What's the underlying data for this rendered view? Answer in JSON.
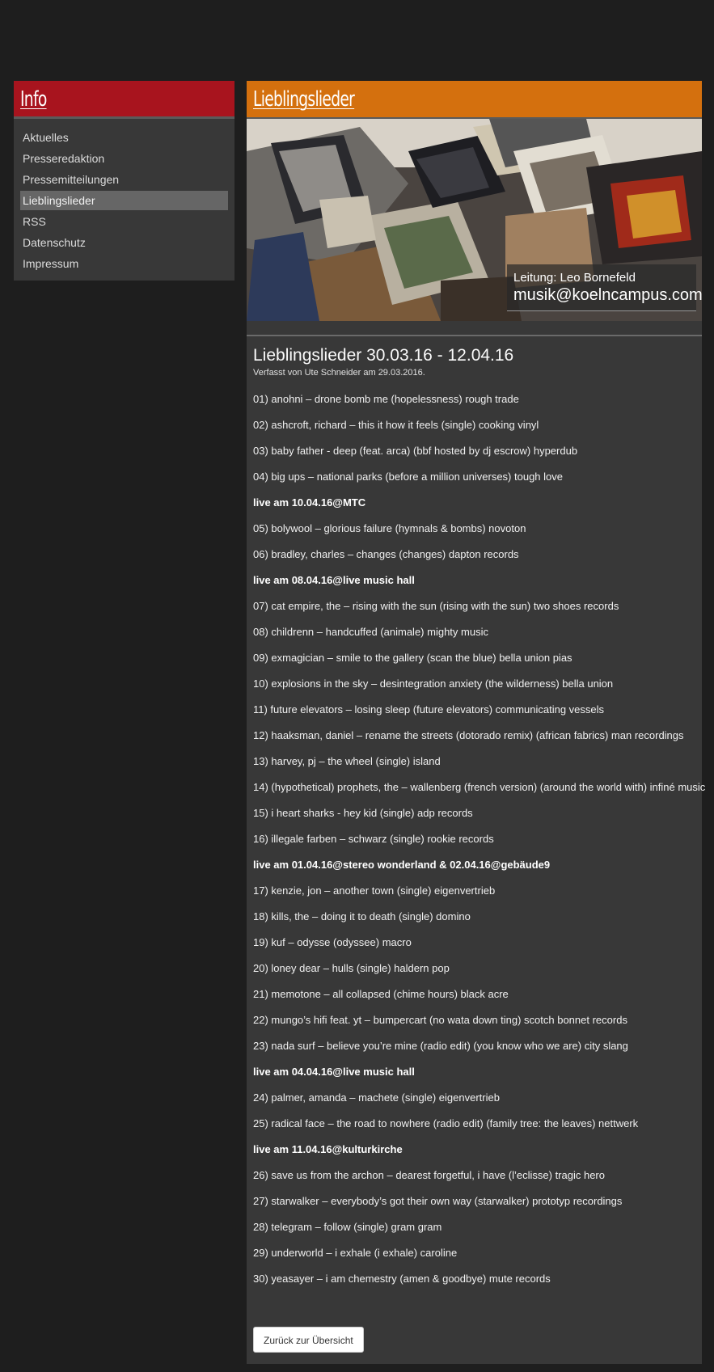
{
  "sidebar": {
    "title": "Info",
    "items": [
      {
        "label": "Aktuelles",
        "active": false
      },
      {
        "label": "Presseredaktion",
        "active": false
      },
      {
        "label": "Pressemitteilungen",
        "active": false
      },
      {
        "label": "Lieblingslieder",
        "active": true
      },
      {
        "label": "RSS",
        "active": false
      },
      {
        "label": "Datenschutz",
        "active": false
      },
      {
        "label": "Impressum",
        "active": false
      }
    ]
  },
  "main": {
    "title": "Lieblingslieder",
    "hero": {
      "leader": "Leitung: Leo Bornefeld",
      "email": "musik@koelncampus.com"
    },
    "article": {
      "title": "Lieblingslieder 30.03.16 - 12.04.16",
      "byline": "Verfasst von Ute Schneider am 29.03.2016.",
      "entries": [
        {
          "text": "01) anohni – drone bomb me (hopelessness) rough trade",
          "live": false
        },
        {
          "text": "02) ashcroft, richard – this it how it feels (single) cooking vinyl",
          "live": false
        },
        {
          "text": "03) baby father - deep (feat. arca) (bbf hosted by dj escrow) hyperdub",
          "live": false
        },
        {
          "text": "04) big ups – national parks (before a million universes) tough love",
          "live": false
        },
        {
          "text": "live am 10.04.16@MTC",
          "live": true
        },
        {
          "text": "05) bolywool – glorious failure (hymnals & bombs) novoton",
          "live": false
        },
        {
          "text": "06) bradley, charles – changes (changes) dapton records",
          "live": false
        },
        {
          "text": "live am 08.04.16@live music hall",
          "live": true
        },
        {
          "text": "07) cat empire, the – rising with the sun (rising with the sun) two shoes records",
          "live": false
        },
        {
          "text": "08) childrenn – handcuffed (animale) mighty music",
          "live": false
        },
        {
          "text": "09) exmagician – smile to the gallery (scan the blue) bella union pias",
          "live": false
        },
        {
          "text": "10) explosions in the sky – desintegration anxiety (the wilderness) bella union",
          "live": false
        },
        {
          "text": "11) future elevators – losing sleep (future elevators) communicating vessels",
          "live": false
        },
        {
          "text": "12) haaksman, daniel – rename the streets (dotorado remix) (african fabrics) man recordings",
          "live": false
        },
        {
          "text": "13) harvey, pj – the wheel (single) island",
          "live": false
        },
        {
          "text": "14) (hypothetical) prophets, the – wallenberg (french version) (around the world with) infiné music",
          "live": false
        },
        {
          "text": "15) i heart sharks - hey kid (single) adp records",
          "live": false
        },
        {
          "text": "16) illegale farben – schwarz (single) rookie records",
          "live": false
        },
        {
          "text": "live am 01.04.16@stereo wonderland & 02.04.16@gebäude9",
          "live": true
        },
        {
          "text": "17) kenzie, jon – another town (single) eigenvertrieb",
          "live": false
        },
        {
          "text": "18) kills, the – doing it to death (single) domino",
          "live": false
        },
        {
          "text": "19) kuf – odysse (odyssee) macro",
          "live": false
        },
        {
          "text": "20) loney dear – hulls (single) haldern pop",
          "live": false
        },
        {
          "text": "21) memotone – all collapsed (chime hours) black acre",
          "live": false
        },
        {
          "text": "22) mungo’s hifi feat. yt – bumpercart (no wata down ting) scotch bonnet records",
          "live": false
        },
        {
          "text": "23) nada surf – believe you’re mine (radio edit) (you know who we are) city slang",
          "live": false
        },
        {
          "text": "live am 04.04.16@live music hall",
          "live": true
        },
        {
          "text": "24) palmer, amanda – machete (single) eigenvertrieb",
          "live": false
        },
        {
          "text": "25) radical face – the road to nowhere (radio edit) (family tree: the leaves) nettwerk",
          "live": false
        },
        {
          "text": "live am 11.04.16@kulturkirche",
          "live": true
        },
        {
          "text": "26) save us from the archon – dearest forgetful, i have (l’eclisse) tragic hero",
          "live": false
        },
        {
          "text": "27) starwalker – everybody’s got their own way (starwalker) prototyp recordings",
          "live": false
        },
        {
          "text": "28) telegram – follow (single) gram gram",
          "live": false
        },
        {
          "text": "29) underworld – i exhale (i exhale) caroline",
          "live": false
        },
        {
          "text": "30) yeasayer – i am chemestry (amen & goodbye) mute records",
          "live": false
        }
      ],
      "back_label": "Zurück zur Übersicht"
    }
  }
}
